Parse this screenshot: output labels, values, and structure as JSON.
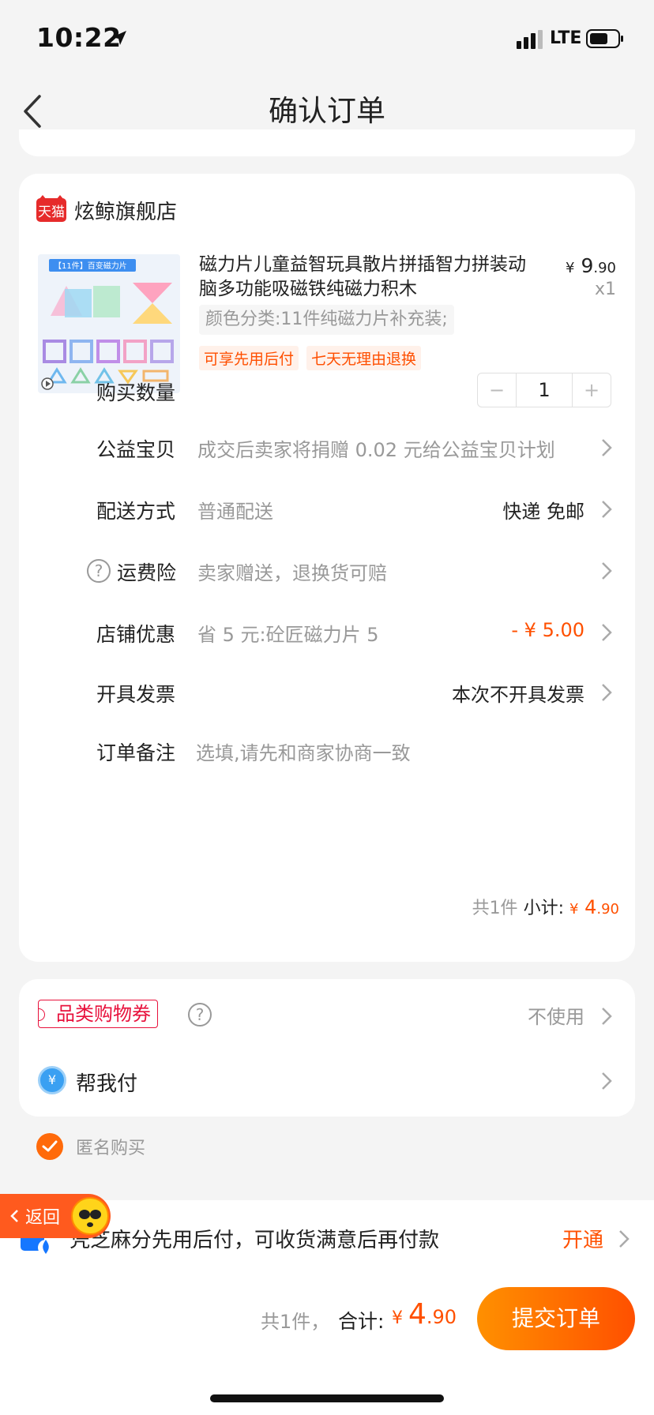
{
  "status": {
    "time": "10:22",
    "network": "LTE"
  },
  "nav": {
    "title": "确认订单"
  },
  "shop": {
    "badge": "天猫",
    "name": "炫鲸旗舰店"
  },
  "product": {
    "title": "磁力片儿童益智玩具散片拼插智力拼装动脑多功能吸磁铁纯磁力积木",
    "price_symbol": "¥",
    "price_int": "9",
    "price_dec": ".90",
    "quantity_label": "x1",
    "sku": "颜色分类:11件纯磁力片补充装;",
    "tags": [
      "可享先用后付",
      "七天无理由退换"
    ],
    "thumb_banner": "【11件】百变磁力片"
  },
  "rows": {
    "quantity": {
      "label": "购买数量",
      "value": "1",
      "minus": "−",
      "plus": "+"
    },
    "charity": {
      "label": "公益宝贝",
      "value": "成交后卖家将捐赠 0.02 元给公益宝贝计划"
    },
    "delivery": {
      "label": "配送方式",
      "value": "普通配送",
      "right": "快递 免邮"
    },
    "insurance": {
      "label": "运费险",
      "value": "卖家赠送，退换货可赔",
      "help": "?"
    },
    "shop_discount": {
      "label": "店铺优惠",
      "value": "省 5 元:砼匠磁力片 5",
      "right": "- ¥ 5.00"
    },
    "invoice": {
      "label": "开具发票",
      "right": "本次不开具发票"
    },
    "note": {
      "label": "订单备注",
      "placeholder": "选填,请先和商家协商一致"
    }
  },
  "subtotal": {
    "count": "共1件",
    "label": "小计:",
    "symbol": "¥",
    "int": "4",
    "dec": ".90"
  },
  "coupon": {
    "label": "品类购物券",
    "help": "?",
    "value": "不使用"
  },
  "helppay": {
    "icon": "¥",
    "label": "帮我付"
  },
  "anonymous": {
    "label": "匿名购买",
    "checked": true
  },
  "promo": {
    "text": "凭芝麻分先用后付，可收货满意后再付款",
    "action": "开通"
  },
  "floating_return": {
    "label": "返回"
  },
  "bottom": {
    "count": "共1件，",
    "total_label": "合计:",
    "symbol": "¥",
    "int": "4",
    "dec": ".90",
    "submit": "提交订单"
  },
  "colors": {
    "accent": "#ff5000",
    "tmall_red": "#e62b2b",
    "coupon_red": "#e8113c"
  }
}
